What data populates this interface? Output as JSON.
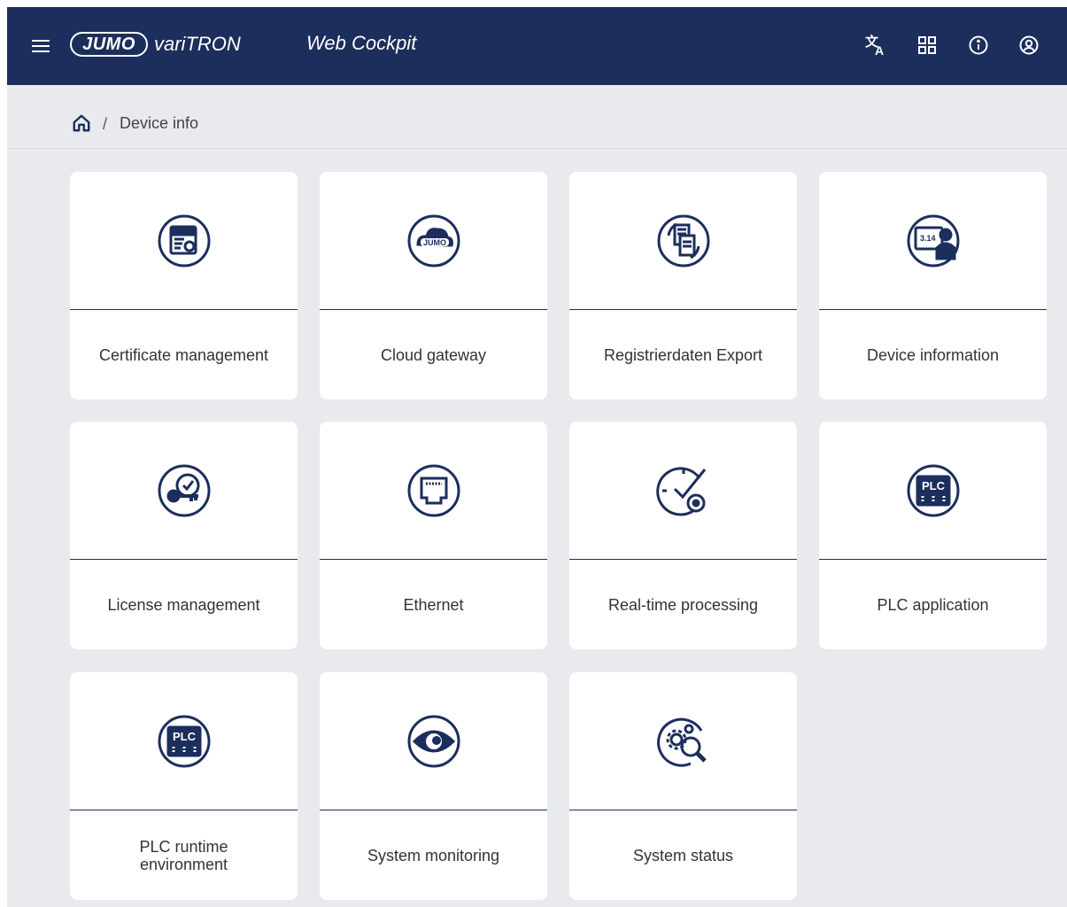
{
  "header": {
    "logo_brand": "JUMO",
    "logo_product": "variTRON",
    "app_title": "Web Cockpit",
    "icons": [
      "translate-icon",
      "qr-code-icon",
      "info-icon",
      "account-icon"
    ]
  },
  "breadcrumb": {
    "home_icon": "home-icon",
    "separator": "/",
    "current": "Device info"
  },
  "tiles": [
    {
      "label": "Certificate management",
      "icon": "certificate-icon"
    },
    {
      "label": "Cloud gateway",
      "icon": "cloud-icon"
    },
    {
      "label": "Registrierdaten Export",
      "icon": "export-icon"
    },
    {
      "label": "Device information",
      "icon": "device-info-icon"
    },
    {
      "label": "License management",
      "icon": "license-key-icon"
    },
    {
      "label": "Ethernet",
      "icon": "ethernet-icon"
    },
    {
      "label": "Real-time processing",
      "icon": "clock-icon"
    },
    {
      "label": "PLC application",
      "icon": "plc-icon"
    },
    {
      "label": "PLC runtime environment",
      "icon": "plc-icon"
    },
    {
      "label": "System monitoring",
      "icon": "eye-icon"
    },
    {
      "label": "System status",
      "icon": "gear-search-icon"
    }
  ],
  "colors": {
    "header_bg": "#1c2e5c",
    "page_bg": "#e9eaee",
    "icon": "#1c2e5c"
  }
}
